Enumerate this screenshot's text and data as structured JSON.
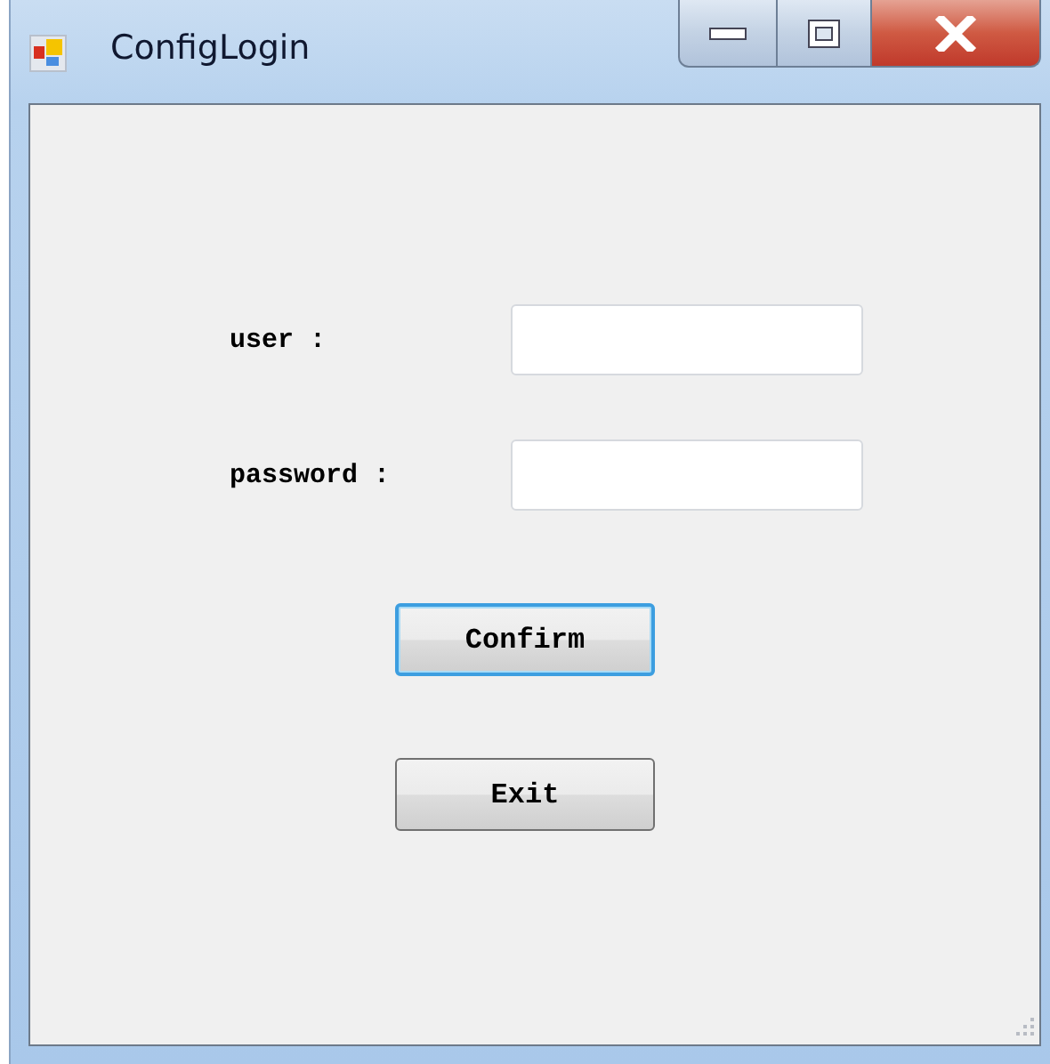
{
  "window": {
    "title": "ConfigLogin"
  },
  "fields": [
    {
      "label": "user :"
    },
    {
      "label": "password :"
    }
  ],
  "buttons": [
    {
      "label": "Confirm",
      "focused": true
    },
    {
      "label": "Exit",
      "focused": false
    }
  ]
}
